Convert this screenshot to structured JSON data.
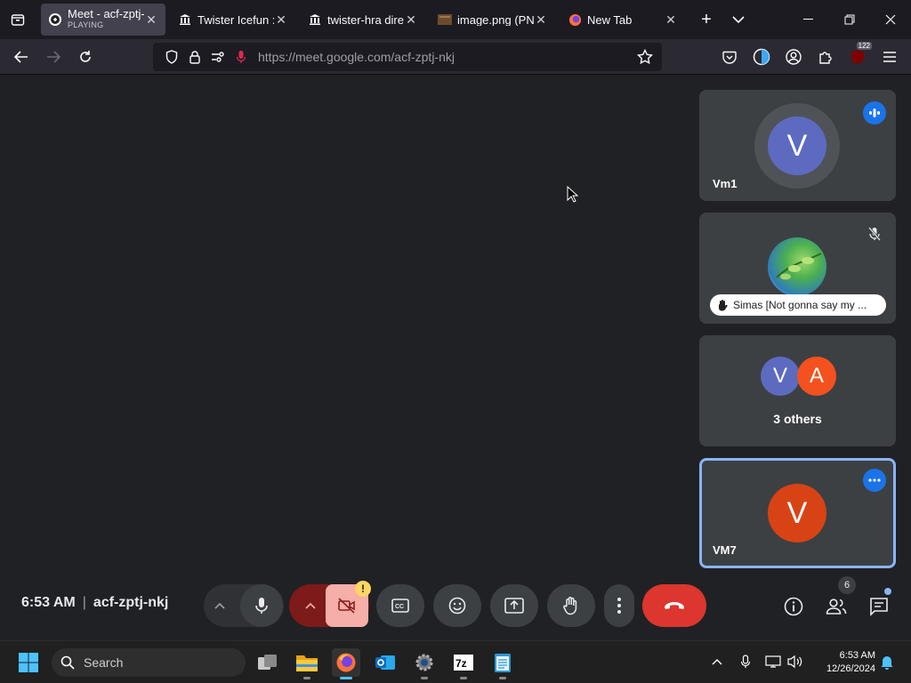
{
  "browser": {
    "tabs": [
      {
        "title": "Meet - acf-zptj-",
        "subtitle": "PLAYING",
        "active": true
      },
      {
        "title": "Twister Icefun : /",
        "active": false
      },
      {
        "title": "twister-hra direc",
        "active": false
      },
      {
        "title": "image.png (PNG",
        "active": false
      },
      {
        "title": "New Tab",
        "active": false
      }
    ],
    "url": "https://meet.google.com/acf-zptj-nkj",
    "extension_badge": "122"
  },
  "meet": {
    "participants": [
      {
        "name": "Vm1",
        "initial": "V",
        "color": "#5c6bc0"
      },
      {
        "name": "Simas [Not gonna say my ...",
        "initial": "",
        "color": "#4caf50"
      },
      {
        "name": "3 others",
        "initials": [
          "V",
          "A"
        ],
        "colors": [
          "#5c6bc0",
          "#f4511e"
        ]
      },
      {
        "name": "VM7",
        "initial": "V",
        "color": "#d84315"
      }
    ],
    "time": "6:53 AM",
    "meeting_code": "acf-zptj-nkj",
    "people_count": "6",
    "warning_badge": "!"
  },
  "taskbar": {
    "search_placeholder": "Search",
    "clock_time": "6:53 AM",
    "clock_date": "12/26/2024"
  }
}
